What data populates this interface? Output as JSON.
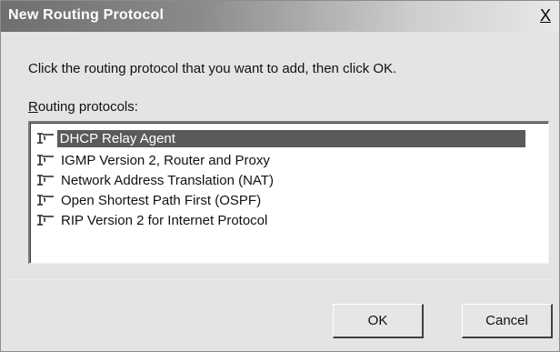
{
  "window": {
    "title": "New Routing Protocol",
    "close_label": "X"
  },
  "instruction": "Click the routing protocol that you want to add, then click OK.",
  "list": {
    "label_prefix": "R",
    "label_rest": "outing protocols:",
    "items": [
      {
        "label": "DHCP Relay Agent",
        "selected": true
      },
      {
        "label": "IGMP Version 2, Router and Proxy",
        "selected": false
      },
      {
        "label": "Network Address Translation (NAT)",
        "selected": false
      },
      {
        "label": "Open Shortest Path First (OSPF)",
        "selected": false
      },
      {
        "label": "RIP Version 2 for Internet Protocol",
        "selected": false
      }
    ]
  },
  "buttons": {
    "ok": "OK",
    "cancel": "Cancel"
  },
  "colors": {
    "selection": "#5a5a5a",
    "dialog_bg": "#e4e4e4"
  }
}
